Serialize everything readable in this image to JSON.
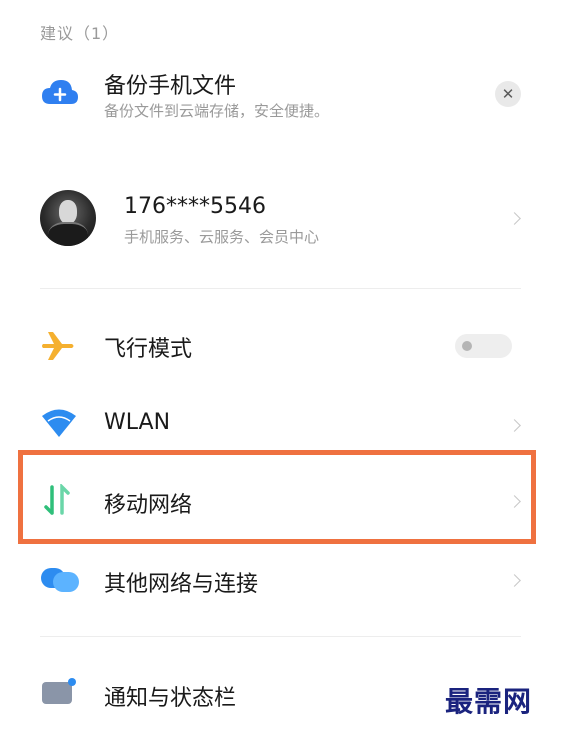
{
  "section": {
    "suggestions_label": "建议（1）"
  },
  "backup_card": {
    "title": "备份手机文件",
    "subtitle": "备份文件到云端存储，安全便捷。",
    "close_symbol": "✕",
    "icon": "cloud-upload-icon"
  },
  "account": {
    "phone": "176****5546",
    "subtitle": "手机服务、云服务、会员中心",
    "icon": "avatar"
  },
  "settings": {
    "airplane": {
      "label": "飞行模式",
      "icon": "airplane-icon",
      "toggle_on": false
    },
    "wlan": {
      "label": "WLAN",
      "icon": "wifi-icon"
    },
    "mobile_network": {
      "label": "移动网络",
      "icon": "mobile-data-icon",
      "highlighted": true
    },
    "other_networks": {
      "label": "其他网络与连接",
      "icon": "connections-icon"
    },
    "notifications": {
      "label": "通知与状态栏",
      "icon": "notification-icon"
    }
  },
  "colors": {
    "highlight": "#ef7140",
    "cloud_blue": "#2f7ff0",
    "airplane_yellow": "#f5b02f",
    "wifi_blue": "#2d8cf0",
    "mobile_green": "#3ec28f"
  },
  "watermark": "最需网"
}
